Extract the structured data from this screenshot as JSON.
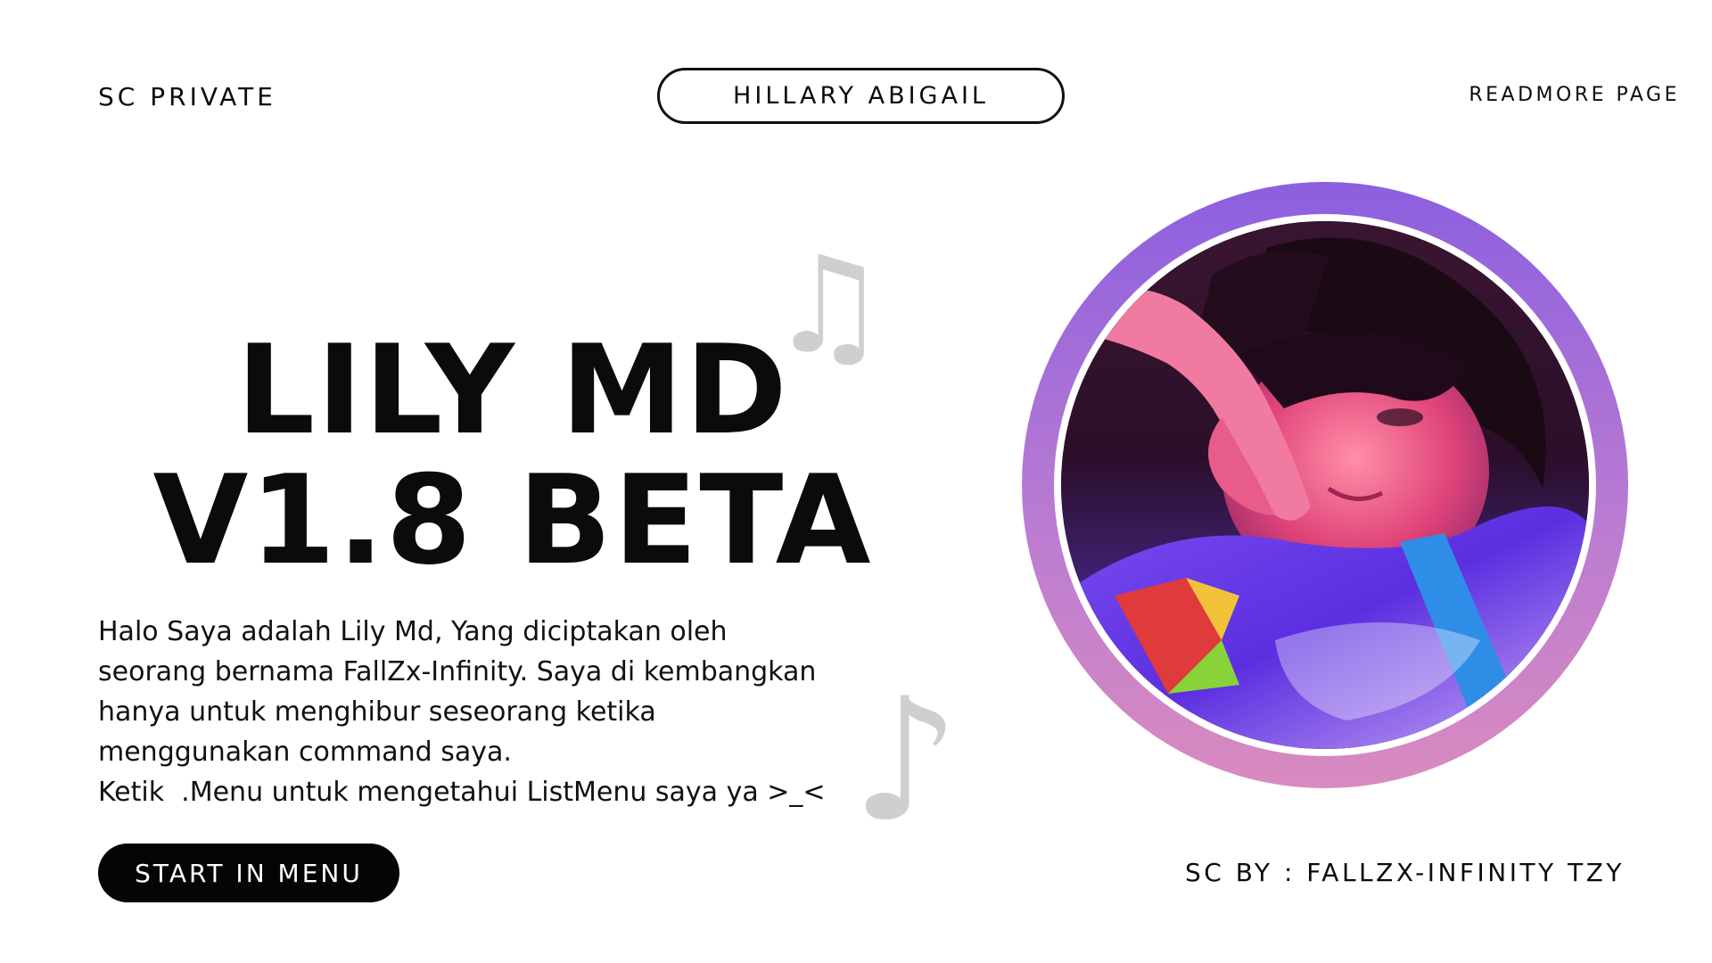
{
  "header": {
    "left_label": "SC PRIVATE",
    "center_pill": "HILLARY ABIGAIL",
    "right_link": "READMORE PAGE"
  },
  "hero": {
    "title_line1": "LILY MD",
    "title_line2": "V1.8 BETA"
  },
  "description": {
    "line1": "Halo Saya adalah Lily Md, Yang diciptakan oleh",
    "line2": "seorang bernama FallZx-Infinity. Saya di kembangkan",
    "line3": "hanya untuk menghibur seseorang ketika",
    "line4": "menggunakan command saya.",
    "line5": "Ketik  .Menu untuk mengetahui ListMenu saya ya >_<"
  },
  "start_button": "START IN MENU",
  "credit": "SC BY : FALLZX-INFINITY TZY",
  "decor": {
    "note_top": "♫",
    "note_bottom": "♪"
  },
  "colors": {
    "ring_top": "#8c5fe0",
    "ring_bottom": "#d98bbf",
    "button_bg": "#050505",
    "note_gray": "#cfcfcf"
  }
}
